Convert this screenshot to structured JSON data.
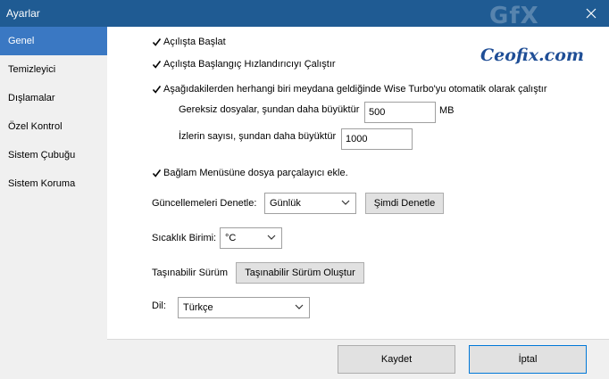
{
  "window": {
    "title": "Ayarlar"
  },
  "watermark": {
    "text": "Ceofix.com",
    "gfx": "GfX"
  },
  "sidebar": {
    "items": [
      {
        "label": "Genel",
        "active": true
      },
      {
        "label": "Temizleyici"
      },
      {
        "label": "Dışlamalar"
      },
      {
        "label": "Özel Kontrol"
      },
      {
        "label": "Sistem Çubuğu"
      },
      {
        "label": "Sistem Koruma"
      }
    ]
  },
  "general": {
    "start_on_boot": {
      "label": "Açılışta Başlat",
      "checked": true
    },
    "boot_accelerator": {
      "label": "Açılışta Başlangıç Hızlandırıcıyı Çalıştır",
      "checked": true
    },
    "auto_run": {
      "label": "Aşağıdakilerden herhangi biri meydana geldiğinde Wise Turbo'yu otomatik olarak çalıştır",
      "checked": true
    },
    "junk_files": {
      "label": "Gereksiz dosyalar, şundan daha büyüktür",
      "value": "500",
      "unit": "MB"
    },
    "traces": {
      "label": "İzlerin sayısı, şundan daha büyüktür",
      "value": "1000"
    },
    "context_menu": {
      "label": "Bağlam Menüsüne dosya parçalayıcı ekle.",
      "checked": true
    },
    "updates": {
      "label": "Güncellemeleri Denetle:",
      "selected": "Günlük",
      "check_now": "Şimdi Denetle"
    },
    "temperature": {
      "label": "Sıcaklık Birimi:",
      "selected": "°C"
    },
    "portable": {
      "label": "Taşınabilir Sürüm",
      "button": "Taşınabilir Sürüm Oluştur"
    },
    "language": {
      "label": "Dil:",
      "selected": "Türkçe"
    }
  },
  "footer": {
    "save": "Kaydet",
    "cancel": "İptal"
  },
  "colors": {
    "titlebar": "#1f5b93",
    "sidebar_active": "#3a78c3",
    "sidebar_bg": "#f0f0f0",
    "watermark_text": "#1f4e96"
  }
}
